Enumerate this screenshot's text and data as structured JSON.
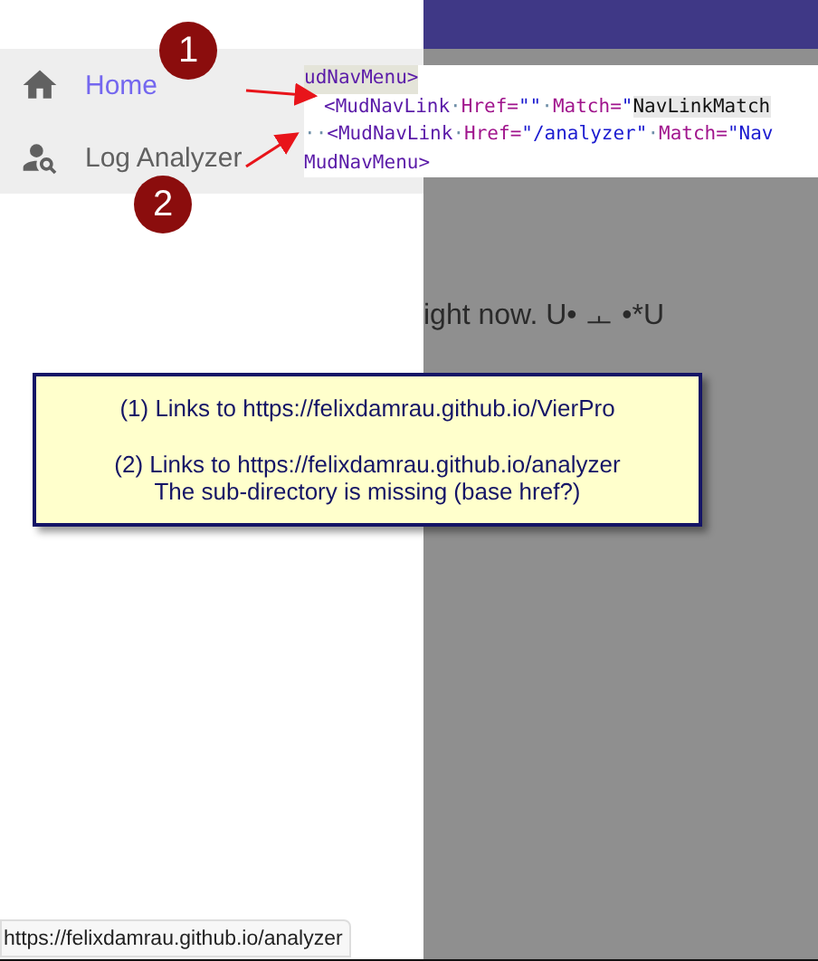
{
  "nav": {
    "items": [
      {
        "label": "Home",
        "selected": true
      },
      {
        "label": "Log Analyzer",
        "selected": false
      }
    ]
  },
  "page_text": "ight now. U• ㅗ •*U",
  "code_snippet": {
    "lines": [
      [
        {
          "text": "udNavMenu>",
          "kind": "tag"
        }
      ],
      [
        {
          "text": "<MudNavLink",
          "kind": "tag"
        },
        {
          "text": "·",
          "kind": "ws"
        },
        {
          "text": "Href=",
          "kind": "attr"
        },
        {
          "text": "\"\"",
          "kind": "string"
        },
        {
          "text": "·",
          "kind": "ws"
        },
        {
          "text": "Match=",
          "kind": "attr"
        },
        {
          "text": "\"",
          "kind": "string"
        },
        {
          "text": "NavLinkMatch",
          "kind": "highlight"
        }
      ],
      [
        {
          "text": "··",
          "kind": "ws"
        },
        {
          "text": "<MudNavLink",
          "kind": "tag"
        },
        {
          "text": "·",
          "kind": "ws"
        },
        {
          "text": "Href=",
          "kind": "attr"
        },
        {
          "text": "\"/analyzer\"",
          "kind": "string"
        },
        {
          "text": "·",
          "kind": "ws"
        },
        {
          "text": "Match=",
          "kind": "attr"
        },
        {
          "text": "\"Nav",
          "kind": "string"
        }
      ],
      [
        {
          "text": "MudNavMenu>",
          "kind": "tag"
        }
      ]
    ]
  },
  "callouts": [
    {
      "label": "1"
    },
    {
      "label": "2"
    }
  ],
  "note": {
    "paragraphs": [
      [
        "(1) Links to https://felixdamrau.github.io/VierPro"
      ],
      [
        "(2) Links to https://felixdamrau.github.io/analyzer",
        "The sub-directory is missing (base href?)"
      ]
    ]
  },
  "status_url": "https://felixdamrau.github.io/analyzer"
}
